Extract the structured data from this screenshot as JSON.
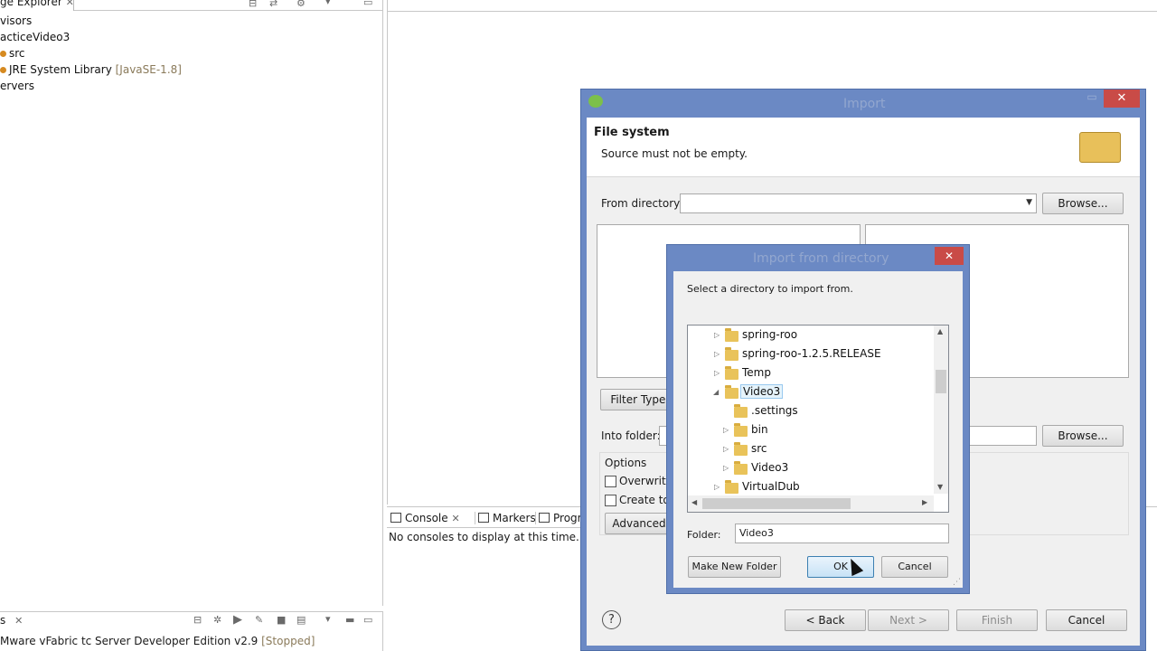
{
  "package_explorer": {
    "tab_label": "ge Explorer",
    "items": [
      {
        "label": "visors"
      },
      {
        "label": "acticeVideo3"
      },
      {
        "label": "src"
      },
      {
        "label": "JRE System Library",
        "suffix": "[JavaSE-1.8]"
      },
      {
        "label": "ervers"
      }
    ]
  },
  "console": {
    "tabs": [
      "Console",
      "Markers",
      "Progr"
    ],
    "message": "No consoles to display at this time."
  },
  "servers": {
    "tab_label": "s",
    "entry": "Mware vFabric tc Server Developer Edition v2.9",
    "status": "[Stopped]"
  },
  "import_dialog": {
    "title": "Import",
    "header_title": "File system",
    "header_message": "Source must not be empty.",
    "from_directory_label": "From directory:",
    "from_directory_value": "",
    "browse_label": "Browse...",
    "filter_types_label": "Filter Types",
    "into_folder_label": "Into folder:",
    "into_folder_value": "",
    "into_browse_label": "Browse...",
    "options_label": "Options",
    "option_overwrite": "Overwrite",
    "option_create": "Create top",
    "advanced_label": "Advanced",
    "buttons": {
      "back": "< Back",
      "next": "Next >",
      "finish": "Finish",
      "cancel": "Cancel"
    },
    "help_icon": "?"
  },
  "dir_dialog": {
    "title": "Import from directory",
    "instruction": "Select a directory to import from.",
    "tree": [
      {
        "label": "spring-roo",
        "expanded": false
      },
      {
        "label": "spring-roo-1.2.5.RELEASE",
        "expanded": false
      },
      {
        "label": "Temp",
        "expanded": false
      },
      {
        "label": "Video3",
        "expanded": true
      },
      {
        "label": ".settings",
        "expanded": null
      },
      {
        "label": "bin",
        "expanded": false
      },
      {
        "label": "src",
        "expanded": false
      },
      {
        "label": "Video3",
        "expanded": false
      },
      {
        "label": "VirtualDub",
        "expanded": false
      }
    ],
    "folder_label": "Folder:",
    "folder_value": "Video3",
    "make_new_folder": "Make New Folder",
    "ok": "OK",
    "cancel": "Cancel"
  },
  "colors": {
    "window_frame": "#6b89c4",
    "dialog_bg": "#f0f0f0",
    "close_button": "#c94b47"
  }
}
